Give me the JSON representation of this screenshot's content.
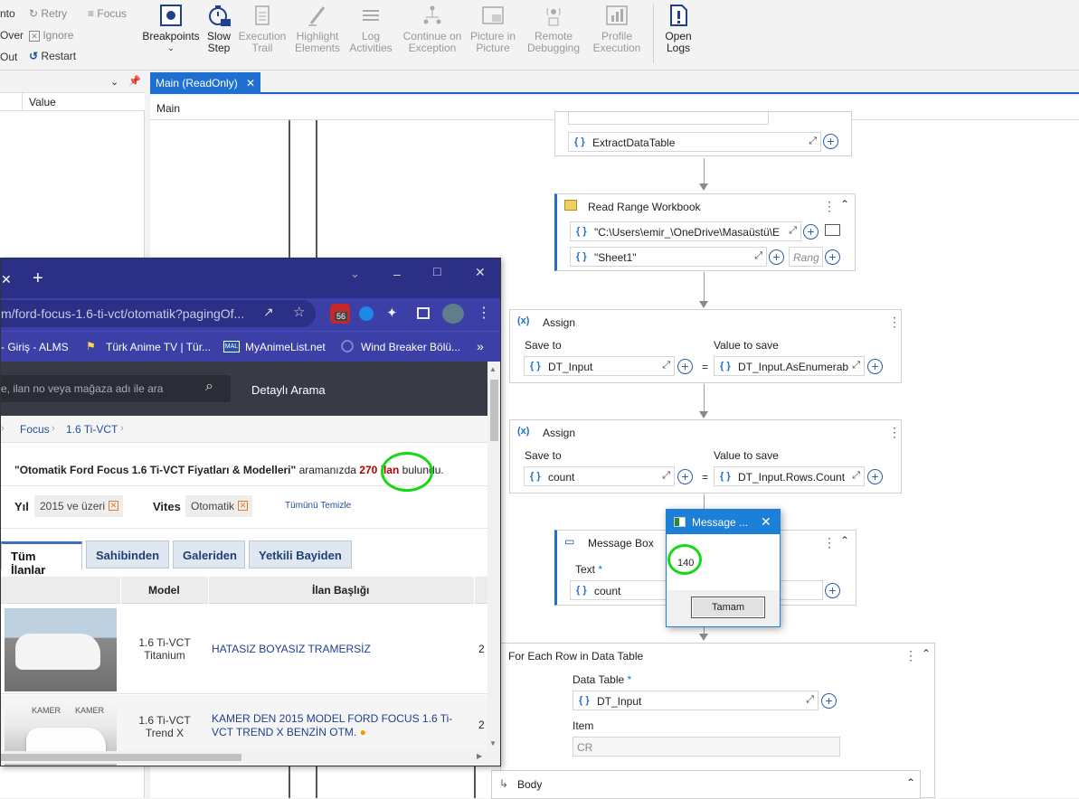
{
  "ribbon": {
    "debug_small": {
      "step_into": "nto",
      "step_over": "Over",
      "step_out": "Out",
      "retry": "Retry",
      "ignore": "Ignore",
      "restart": "Restart",
      "focus": "Focus"
    },
    "buttons": [
      {
        "label": "Breakpoints"
      },
      {
        "label": "Slow Step"
      },
      {
        "label": "Execution Trail"
      },
      {
        "label": "Highlight Elements"
      },
      {
        "label": "Log Activities"
      },
      {
        "label": "Continue on Exception"
      },
      {
        "label": "Picture in Picture"
      },
      {
        "label": "Remote Debugging"
      },
      {
        "label": "Profile Execution"
      },
      {
        "label": "Open Logs"
      }
    ]
  },
  "left_panel": {
    "value_header": "Value"
  },
  "tabs": {
    "active_label": "Main (ReadOnly)"
  },
  "breadcrumb": "Main",
  "workflow": {
    "extract_field": "ExtractDataTable",
    "read_range": {
      "title": "Read Range Workbook",
      "path": "\"C:\\Users\\emir_\\OneDrive\\Masaüstü\\E",
      "sheet": "\"Sheet1\"",
      "range_placeholder": "Rang"
    },
    "assign1": {
      "title": "Assign",
      "save_to_label": "Save to",
      "value_label": "Value to save",
      "save_to": "DT_Input",
      "value": "DT_Input.AsEnumerab"
    },
    "assign2": {
      "title": "Assign",
      "save_to_label": "Save to",
      "value_label": "Value to save",
      "save_to": "count",
      "value": "DT_Input.Rows.Count"
    },
    "message_box": {
      "title": "Message Box",
      "text_label": "Text",
      "required": "*",
      "text_value": "count"
    },
    "for_each": {
      "title": "For Each Row in Data Table",
      "data_table_label": "Data Table",
      "required": "*",
      "data_table": "DT_Input",
      "item_label": "Item",
      "item": "CR",
      "body_label": "Body"
    },
    "equals": "="
  },
  "popup": {
    "title": "Message ...",
    "message": "140",
    "ok_label": "Tamam"
  },
  "browser": {
    "new_tab": "+",
    "url": "m/ford-focus-1.6-ti-vct/otomatik?pagingOf...",
    "url_highlight": "m",
    "bookmarks": [
      "- Giriş - ALMS",
      "Türk Anime TV | Tür...",
      "MyAnimeList.net",
      "Wind Breaker Bölü..."
    ],
    "bookmark_more": "»",
    "extension_badge": "56",
    "search_placeholder": "e, ilan no veya mağaza adı ile ara",
    "detailed_search": "Detaylı Arama",
    "crumbs": [
      "Focus",
      "1.6 Ti-VCT"
    ],
    "summary_quote": "\"Otomatik Ford Focus 1.6 Ti-VCT Fiyatları & Modelleri\"",
    "summary_mid": "aramanızda",
    "summary_count": "270 ilan",
    "summary_end": "bulundu.",
    "filters": {
      "year_label": "Yıl",
      "year_value": "2015 ve üzeri",
      "gear_label": "Vites",
      "gear_value": "Otomatik",
      "clear": "Tümünü Temizle"
    },
    "tabs": [
      "Tüm İlanlar",
      "Sahibinden",
      "Galeriden",
      "Yetkili Bayiden"
    ],
    "columns": [
      "Model",
      "İlan Başlığı"
    ],
    "rows": [
      {
        "model": "1.6 Ti-VCT Titanium",
        "title": "HATASIZ BOYASIZ TRAMERSİZ",
        "extra": "2"
      },
      {
        "model": "1.6 Ti-VCT Trend X",
        "title": "KAMER DEN 2015 MODEL FORD FOCUS 1.6 Ti-VCT TREND X BENZİN OTM.",
        "extra": "2"
      }
    ],
    "thumb2_brand": "KAMER"
  },
  "colors": {
    "accent": "#1f6fd0",
    "browser_frame": "#2b2f86",
    "annotation": "#16d816"
  }
}
